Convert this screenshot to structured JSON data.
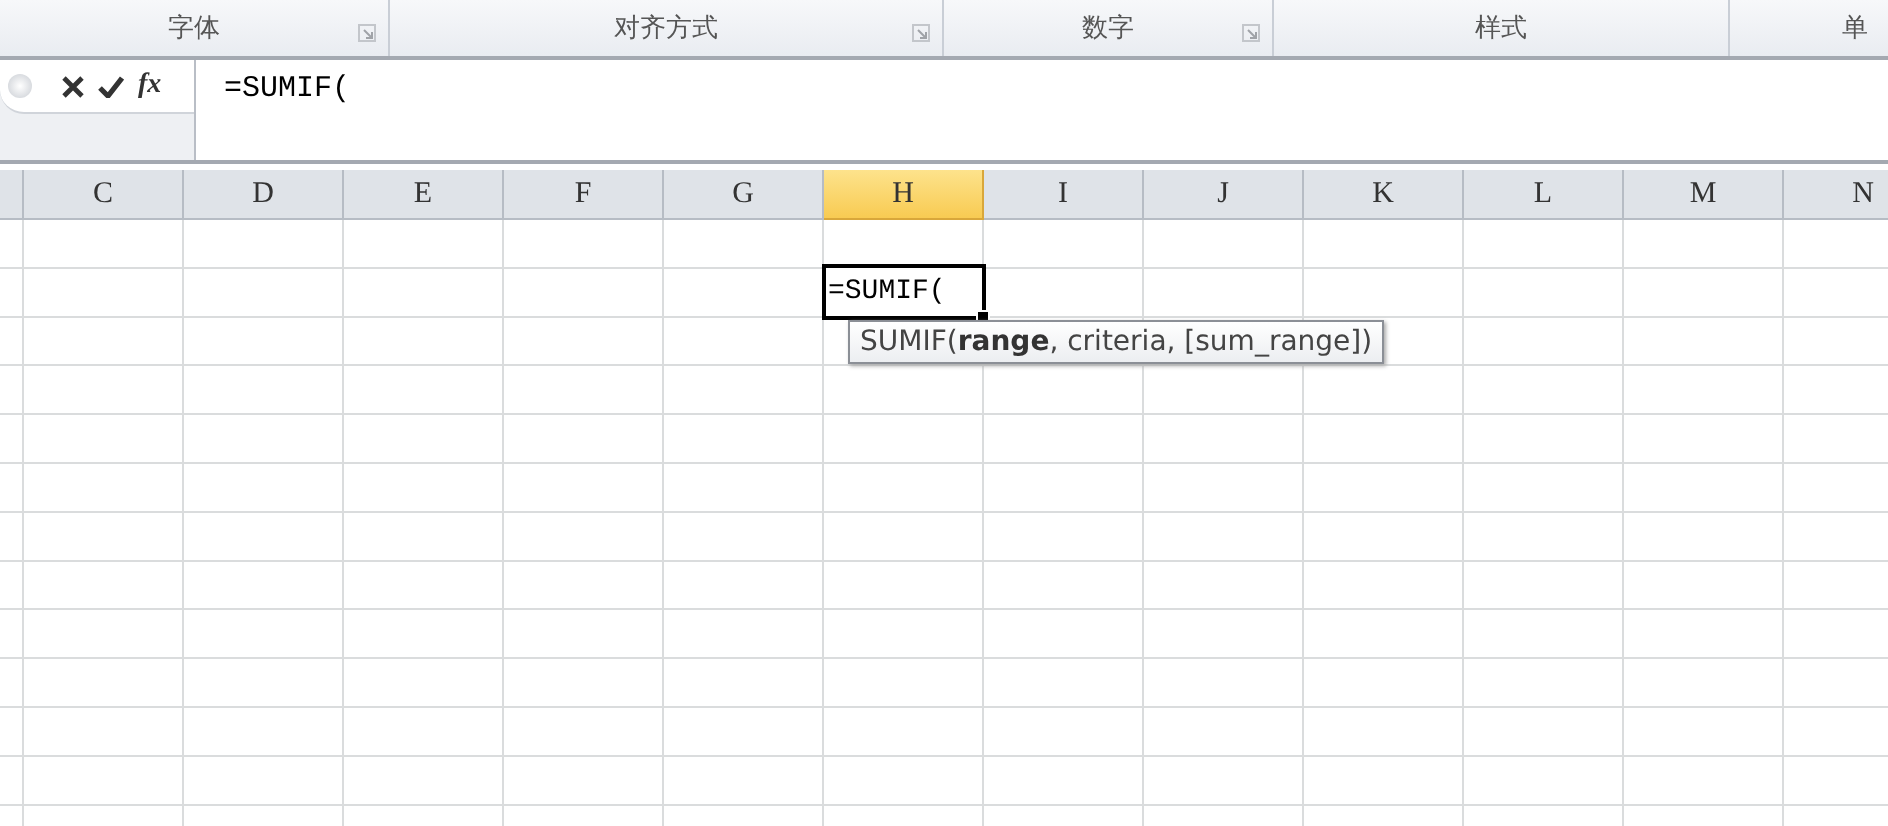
{
  "ribbon_groups": [
    {
      "label": "字体",
      "launcher": true
    },
    {
      "label": "对齐方式",
      "launcher": true
    },
    {
      "label": "数字",
      "launcher": true
    },
    {
      "label": "样式",
      "launcher": false
    },
    {
      "label": "单",
      "launcher": false
    }
  ],
  "formula_bar": {
    "insert_function": "fx",
    "formula": "=SUMIF("
  },
  "columns": [
    {
      "label": "C",
      "selected": false
    },
    {
      "label": "D",
      "selected": false
    },
    {
      "label": "E",
      "selected": false
    },
    {
      "label": "F",
      "selected": false
    },
    {
      "label": "G",
      "selected": false
    },
    {
      "label": "H",
      "selected": true
    },
    {
      "label": "I",
      "selected": false
    },
    {
      "label": "J",
      "selected": false
    },
    {
      "label": "K",
      "selected": false
    },
    {
      "label": "L",
      "selected": false
    },
    {
      "label": "M",
      "selected": false
    },
    {
      "label": "N",
      "selected": false
    }
  ],
  "active_cell": {
    "value": "=SUMIF("
  },
  "tooltip": "SUMIF(**range**, criteria, [sum_range])"
}
